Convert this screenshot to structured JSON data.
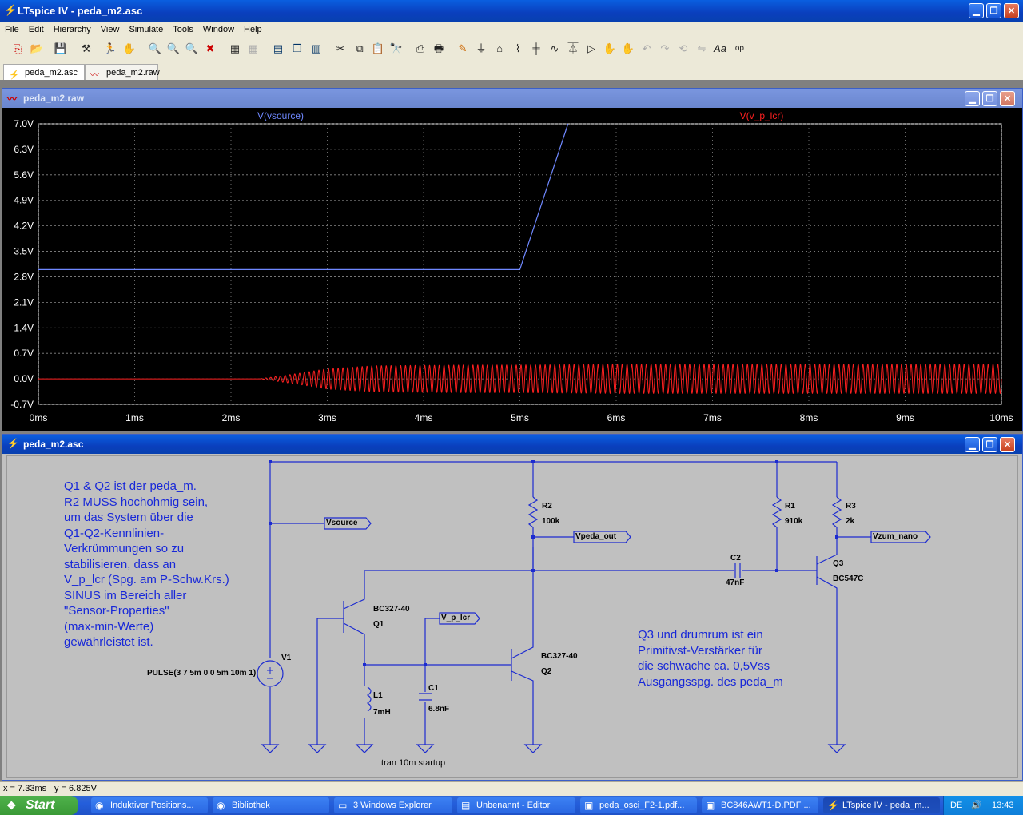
{
  "app": {
    "title": "LTspice IV - peda_m2.asc",
    "menu": [
      "File",
      "Edit",
      "Hierarchy",
      "View",
      "Simulate",
      "Tools",
      "Window",
      "Help"
    ],
    "min_btn": "▁",
    "max_btn": "❐",
    "close_btn": "✕"
  },
  "tabs": [
    {
      "label": "peda_m2.asc",
      "icon": "schematic-icon"
    },
    {
      "label": "peda_m2.raw",
      "icon": "waveform-icon"
    }
  ],
  "waveform_window": {
    "title": "peda_m2.raw",
    "trace_labels": [
      "V(vsource)",
      "V(v_p_lcr)"
    ]
  },
  "chart_data": {
    "type": "line",
    "x_ticks": [
      "0ms",
      "1ms",
      "2ms",
      "3ms",
      "4ms",
      "5ms",
      "6ms",
      "7ms",
      "8ms",
      "9ms",
      "10ms"
    ],
    "y_ticks": [
      "7.0V",
      "6.3V",
      "5.6V",
      "4.9V",
      "4.2V",
      "3.5V",
      "2.8V",
      "2.1V",
      "1.4V",
      "0.7V",
      "0.0V",
      "-0.7V"
    ],
    "xlim": [
      0,
      10
    ],
    "ylim": [
      -0.7,
      7.0
    ],
    "grid": true,
    "series": [
      {
        "name": "V(vsource)",
        "color": "#6f88ff",
        "points": [
          [
            0,
            3
          ],
          [
            5,
            3
          ],
          [
            5.5,
            7
          ]
        ]
      },
      {
        "name": "V(v_p_lcr)",
        "color": "#ff2020",
        "envelope": [
          [
            0,
            0
          ],
          [
            2.3,
            0
          ],
          [
            2.7,
            0.15
          ],
          [
            3.0,
            0.28
          ],
          [
            3.5,
            0.36
          ],
          [
            4.5,
            0.38
          ],
          [
            5.0,
            0.38
          ],
          [
            6.0,
            0.4
          ],
          [
            8.0,
            0.4
          ],
          [
            10,
            0.4
          ]
        ]
      }
    ]
  },
  "schematic_window": {
    "title": "peda_m2.asc",
    "comment_left": "Q1 & Q2 ist der peda_m.\nR2 MUSS hochohmig sein,\num das System über die\nQ1-Q2-Kennlinien-\nVerkrümmungen so zu\nstabilisieren, dass an\nV_p_lcr (Spg. am P-Schw.Krs.)\nSINUS im Bereich aller\n\"Sensor-Properties\"\n(max-min-Werte)\ngewährleistet ist.",
    "comment_right": "Q3 und drumrum ist ein\nPrimitivst-Verstärker für\ndie schwache ca. 0,5Vss\nAusgangsspg. des peda_m",
    "nets": [
      "Vsource",
      "Vpeda_out",
      "V_p_lcr",
      "Vzum_nano"
    ],
    "components": {
      "R2": "R2",
      "R2v": "100k",
      "R1": "R1",
      "R1v": "910k",
      "R3": "R3",
      "R3v": "2k",
      "C2": "C2",
      "C2v": "47nF",
      "C1": "C1",
      "C1v": "6.8nF",
      "L1": "L1",
      "L1v": "7mH",
      "Q1": "Q1",
      "Q1v": "BC327-40",
      "Q2": "Q2",
      "Q2v": "BC327-40",
      "Q3": "Q3",
      "Q3v": "BC547C",
      "V1": "V1",
      "V1v": "PULSE(3 7 5m 0 0 5m 10m 1)"
    },
    "directive": ".tran 10m startup"
  },
  "status_bar": {
    "x": "x = 7.33ms",
    "y": "y = 6.825V"
  },
  "taskbar": {
    "start": "Start",
    "items": [
      {
        "label": "Induktiver Positions...",
        "icon": "firefox-icon"
      },
      {
        "label": "Bibliothek",
        "icon": "firefox-icon"
      },
      {
        "label": "3 Windows Explorer",
        "icon": "folder-icon"
      },
      {
        "label": "Unbenannt - Editor",
        "icon": "notepad-icon"
      },
      {
        "label": "peda_osci_F2-1.pdf...",
        "icon": "pdf-icon"
      },
      {
        "label": "BC846AWT1-D.PDF ...",
        "icon": "pdf-icon"
      },
      {
        "label": "LTspice IV - peda_m...",
        "icon": "ltspice-icon"
      }
    ],
    "lang": "DE",
    "clock": "13:43"
  }
}
